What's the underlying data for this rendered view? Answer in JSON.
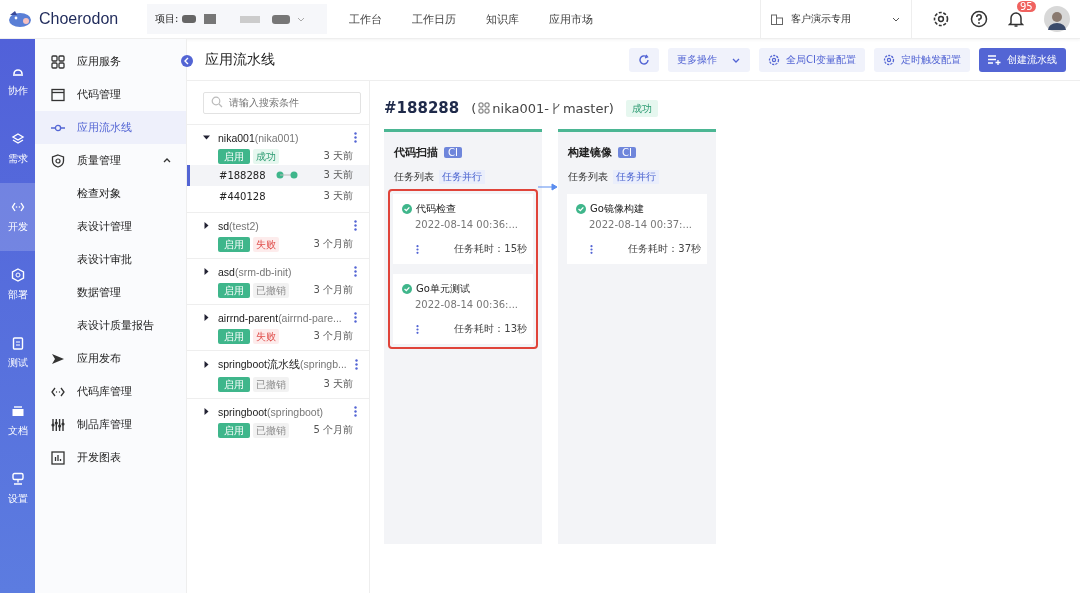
{
  "topbar": {
    "brand": "Choerodon",
    "project_label": "项目:",
    "nav": [
      "工作台",
      "工作日历",
      "知识库",
      "应用市场"
    ],
    "org": "客户演示专用",
    "notification_count": "95"
  },
  "rail": [
    {
      "label": "协作",
      "selected": false
    },
    {
      "label": "需求",
      "selected": false
    },
    {
      "label": "开发",
      "selected": true
    },
    {
      "label": "部署",
      "selected": false
    },
    {
      "label": "测试",
      "selected": false
    },
    {
      "label": "文档",
      "selected": false
    },
    {
      "label": "设置",
      "selected": false
    }
  ],
  "menu": [
    {
      "label": "应用服务",
      "selected": false
    },
    {
      "label": "代码管理",
      "selected": false
    },
    {
      "label": "应用流水线",
      "selected": true
    },
    {
      "label": "质量管理",
      "selected": false,
      "expanded": true,
      "children": [
        {
          "label": "检查对象"
        },
        {
          "label": "表设计管理"
        },
        {
          "label": "表设计审批"
        },
        {
          "label": "数据管理"
        },
        {
          "label": "表设计质量报告"
        }
      ]
    },
    {
      "label": "应用发布",
      "selected": false
    },
    {
      "label": "代码库管理",
      "selected": false
    },
    {
      "label": "制品库管理",
      "selected": false
    },
    {
      "label": "开发图表",
      "selected": false
    }
  ],
  "header": {
    "title": "应用流水线",
    "buttons": [
      {
        "kind": "refresh"
      },
      {
        "kind": "dropdown",
        "label": "更多操作"
      },
      {
        "kind": "gear",
        "label": "全局CI变量配置"
      },
      {
        "kind": "gear",
        "label": "定时触发配置"
      },
      {
        "kind": "primary",
        "label": "创建流水线"
      }
    ]
  },
  "search": {
    "placeholder": "请输入搜索条件"
  },
  "pipelines": [
    {
      "name": "nika001",
      "app": "(nika001)",
      "expanded": true,
      "enabled": "启用",
      "status_tag": {
        "kind": "success",
        "label": "成功"
      },
      "time": "3 天前",
      "runs": [
        {
          "id": "#188288",
          "time": "3 天前",
          "selected": true,
          "stage_dots": [
            {
              "color": "#3fb68b"
            },
            {
              "color": "#3fb68b"
            }
          ]
        },
        {
          "id": "#440128",
          "time": "3 天前",
          "selected": false
        }
      ]
    },
    {
      "name": "sd",
      "app": "(test2)",
      "expanded": false,
      "enabled": "启用",
      "status_tag": {
        "kind": "failed",
        "label": "失败"
      },
      "time": "3 个月前"
    },
    {
      "name": "asd",
      "app": "(srm-db-init)",
      "expanded": false,
      "enabled": "启用",
      "status_tag": {
        "kind": "cancelled",
        "label": "已撤销"
      },
      "time": "3 个月前"
    },
    {
      "name": "airrnd-parent",
      "app": "(airrnd-pare...",
      "expanded": false,
      "enabled": "启用",
      "status_tag": {
        "kind": "failed",
        "label": "失败"
      },
      "time": "3 个月前"
    },
    {
      "name": "springboot流水线",
      "app": "(springb...",
      "expanded": false,
      "enabled": "启用",
      "status_tag": {
        "kind": "cancelled",
        "label": "已撤销"
      },
      "time": "3 天前"
    },
    {
      "name": "springboot",
      "app": "(springboot)",
      "expanded": false,
      "enabled": "启用",
      "status_tag": {
        "kind": "cancelled",
        "label": "已撤销"
      },
      "time": "5 个月前"
    }
  ],
  "detail": {
    "run_id": "#188288",
    "open_paren": "(",
    "app": "nika001-",
    "branch": "master)",
    "status_tag": {
      "kind": "success",
      "label": "成功"
    },
    "stages": [
      {
        "title": "代码扫描",
        "tag": "CI",
        "list_label": "任务列表",
        "mode": "任务并行",
        "highlighted": true,
        "jobs": [
          {
            "name": "代码检查",
            "time": "2022-08-14 00:36:...",
            "duration": "任务耗时：15秒"
          },
          {
            "name": "Go单元测试",
            "time": "2022-08-14 00:36:...",
            "duration": "任务耗时：13秒"
          }
        ]
      },
      {
        "title": "构建镜像",
        "tag": "CI",
        "list_label": "任务列表",
        "mode": "任务并行",
        "highlighted": false,
        "jobs": [
          {
            "name": "Go镜像构建",
            "time": "2022-08-14 00:37:...",
            "duration": "任务耗时：37秒"
          }
        ]
      }
    ]
  }
}
